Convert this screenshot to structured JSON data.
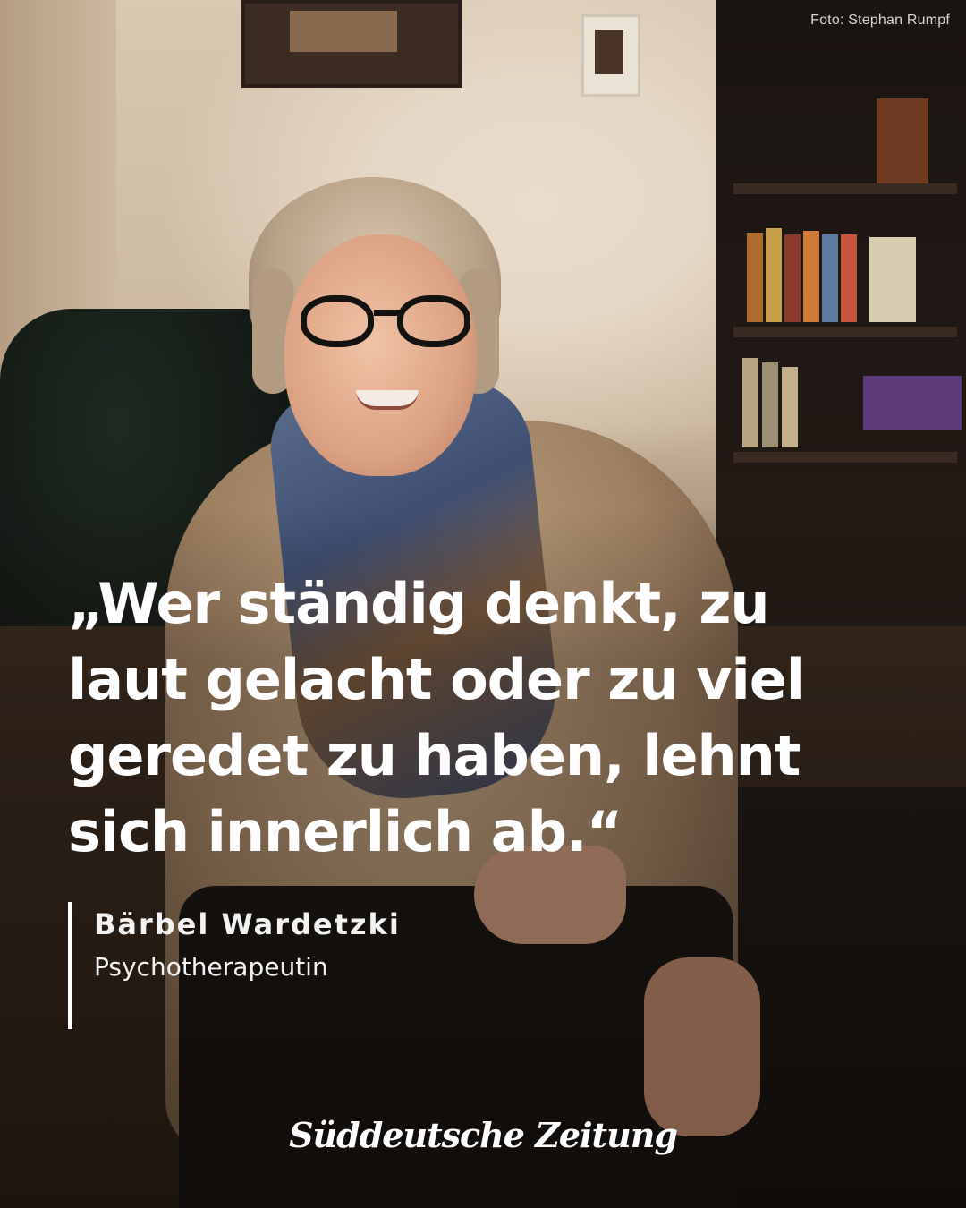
{
  "photo_credit": "Foto: Stephan Rumpf",
  "quote": {
    "lines": [
      "„Wer ständig denkt, zu",
      "laut gelacht oder zu viel",
      "geredet zu haben, lehnt",
      "sich innerlich ab.“"
    ]
  },
  "attribution": {
    "name": "Bärbel Wardetzki",
    "role": "Psychotherapeutin"
  },
  "brand": {
    "logo_text": "Süddeutsche Zeitung"
  },
  "colors": {
    "text": "#ffffff",
    "attribution_bar": "#ffffff"
  }
}
